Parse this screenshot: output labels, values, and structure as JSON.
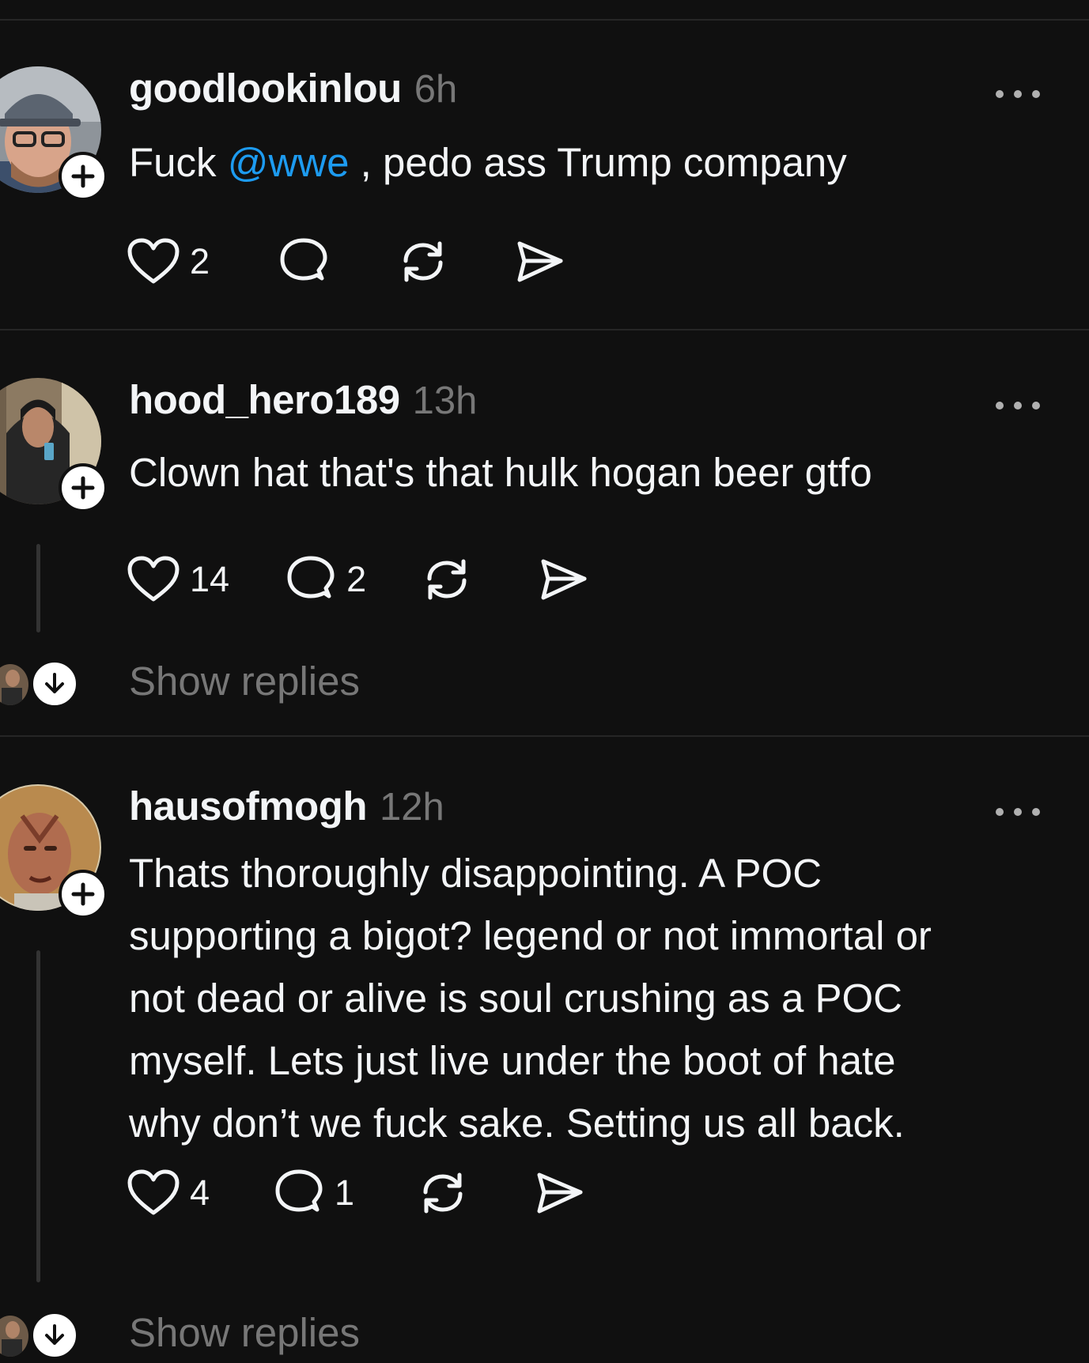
{
  "posts": [
    {
      "username": "goodlookinlou",
      "time": "6h",
      "text_before": "Fuck ",
      "mention": "@wwe",
      "text_after": " , pedo ass Trump company",
      "likes": "2",
      "replies": "",
      "has_show_replies": false
    },
    {
      "username": "hood_hero189",
      "time": "13h",
      "text": "Clown hat that's that hulk hogan beer gtfo",
      "likes": "14",
      "replies": "2",
      "show_replies_label": "Show replies"
    },
    {
      "username": "hausofmogh",
      "time": "12h",
      "lines": [
        "Thats thoroughly disappointing. A POC",
        "supporting a bigot? legend or not immortal or",
        "not dead or alive is soul crushing as a POC",
        "myself. Lets just live under the boot of hate",
        "why don’t we fuck sake. Setting us all back."
      ],
      "likes": "4",
      "replies": "1",
      "show_replies_label": "Show replies"
    }
  ],
  "icons": {
    "like": "heart-icon",
    "reply": "speech-bubble-icon",
    "repost": "repost-arrows-icon",
    "share": "paper-plane-icon",
    "more": "ellipsis-icon",
    "follow": "plus-icon",
    "expand": "arrow-down-icon"
  },
  "colors": {
    "background": "#101010",
    "text": "#f3f5f7",
    "muted": "#777777",
    "mention": "#1d9bf0",
    "divider": "#262626"
  }
}
